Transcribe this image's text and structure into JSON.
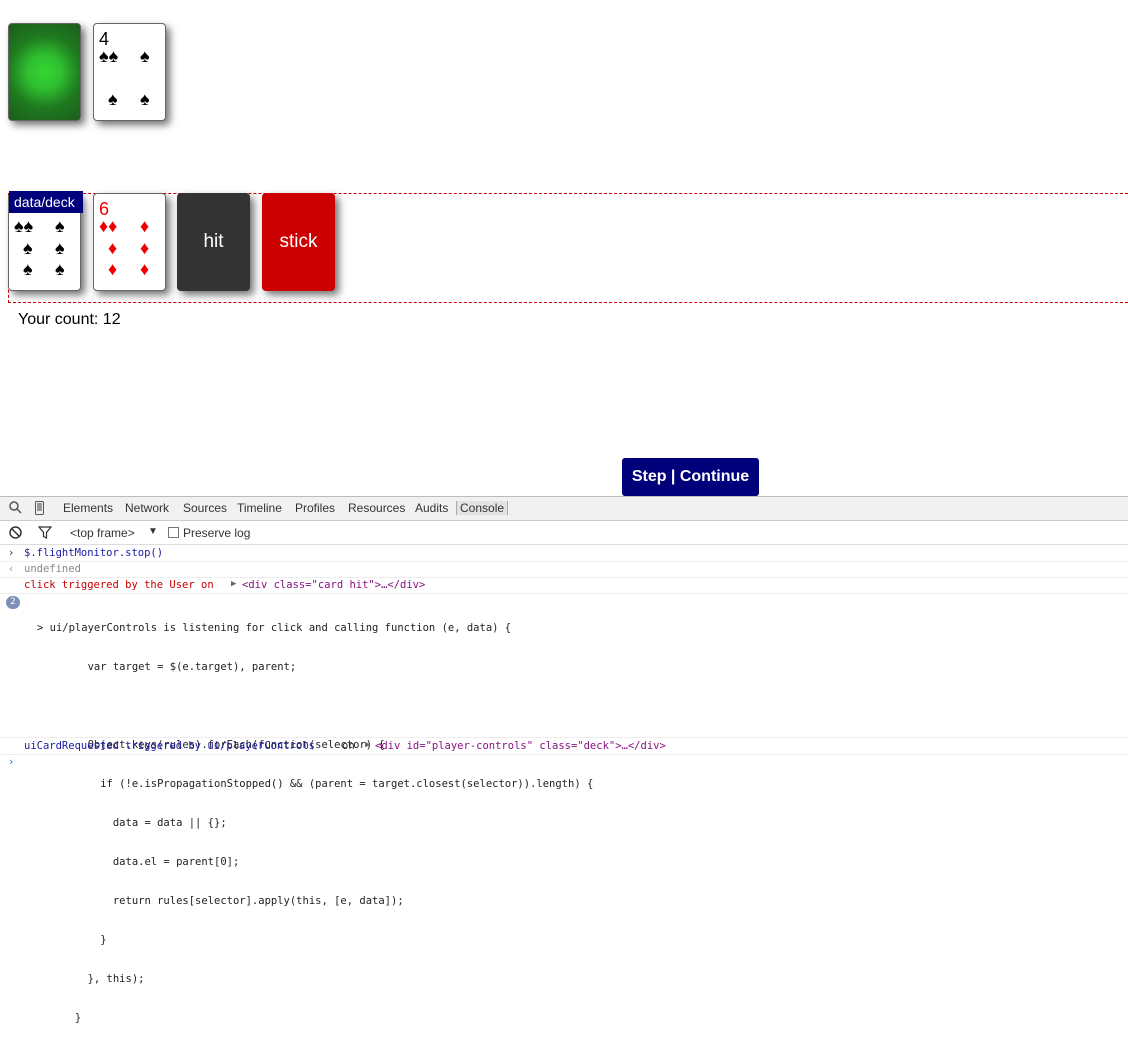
{
  "dealer_hand": {
    "back_card": {
      "kind": "card-back"
    },
    "card_two": {
      "rank": "4",
      "suit": "♠",
      "pips_left": "♠♠",
      "pips": [
        "♠",
        "♠",
        "♠",
        "♠"
      ]
    }
  },
  "player_hand": {
    "deck_label": "data/deck",
    "card_one": {
      "pips_left": "♠♠",
      "pips": [
        "♠",
        "♠",
        "♠",
        "♠",
        "♠",
        "♠"
      ]
    },
    "card_two": {
      "rank": "6",
      "pips_left": "♦♦",
      "pips": [
        "♦",
        "♦",
        "♦",
        "♦",
        "♦"
      ]
    },
    "hit_label": "hit",
    "stick_label": "stick"
  },
  "count_text": "Your count: 12",
  "step_button": "Step | Continue",
  "devtools": {
    "tabs": [
      "Elements",
      "Network",
      "Sources",
      "Timeline",
      "Profiles",
      "Resources",
      "Audits",
      "Console"
    ],
    "frame_selector": "<top frame>",
    "preserve_log": "Preserve log",
    "console": {
      "line1": "$.flightMonitor.stop()",
      "line2": "undefined",
      "line3a": "click triggered by the User on ",
      "line3b": "<div class=\"card hit\">…</div>",
      "badge": "2",
      "code": [
        "> ui/playerControls is listening for click and calling function (e, data) {",
        "        var target = $(e.target), parent;",
        "",
        "        Object.keys(rules).forEach(function(selector) {",
        "          if (!e.isPropagationStopped() && (parent = target.closest(selector)).length) {",
        "            data = data || {};",
        "            data.el = parent[0];",
        "            return rules[selector].apply(this, [e, data]);",
        "          }",
        "        }, this);",
        "      }"
      ],
      "line_last_a": "uiCardRequested triggered by ui/playerControls",
      "line_last_b": "on",
      "line_last_c": "<div id=\"player-controls\" class=\"deck\">…</div>"
    },
    "colors": {
      "blue": "#1a1aa6",
      "red": "#c80000",
      "gray": "#888"
    }
  }
}
